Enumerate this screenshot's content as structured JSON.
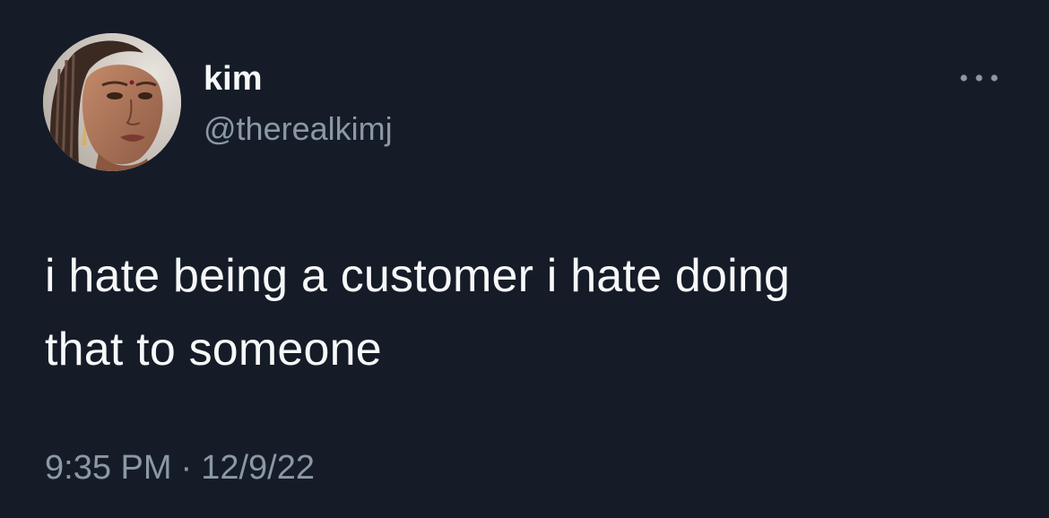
{
  "tweet": {
    "author": {
      "display_name": "kim",
      "handle": "@therealkimj"
    },
    "text_line_1": "i hate being a customer i hate doing",
    "text_line_2": "that to someone",
    "time": "9:35 PM",
    "separator": "·",
    "date": "12/9/22",
    "more_icon": "more-horizontal-icon"
  },
  "colors": {
    "background": "#151c28",
    "primary_text": "#f7f9f9",
    "secondary_text": "#8b98a5"
  }
}
